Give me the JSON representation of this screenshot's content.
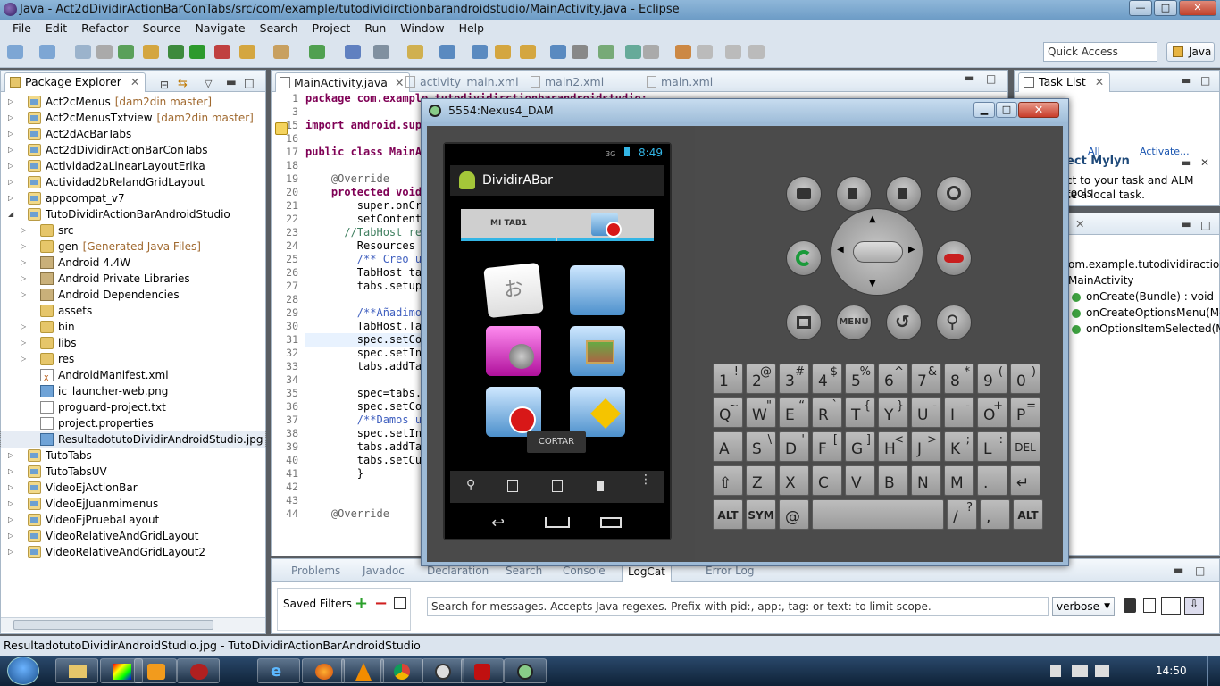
{
  "window": {
    "title": "Java - Act2dDividirActionBarConTabs/src/com/example/tutodividirctionbarandroidstudio/MainActivity.java - Eclipse",
    "min": "—",
    "max": "□",
    "close": "✕"
  },
  "menu": [
    "File",
    "Edit",
    "Refactor",
    "Source",
    "Navigate",
    "Search",
    "Project",
    "Run",
    "Window",
    "Help"
  ],
  "toolbar": {
    "quick_access": "Quick Access",
    "perspective": "Java"
  },
  "package_explorer": {
    "title": "Package Explorer",
    "items": [
      {
        "label": "Act2cMenus",
        "deco": "[dam2din master]",
        "indent": 0,
        "type": "proj",
        "tw": "▷"
      },
      {
        "label": "Act2cMenusTxtview",
        "deco": "[dam2din master]",
        "indent": 0,
        "type": "proj",
        "tw": "▷"
      },
      {
        "label": "Act2dAcBarTabs",
        "deco": "",
        "indent": 0,
        "type": "proj",
        "tw": "▷"
      },
      {
        "label": "Act2dDividirActionBarConTabs",
        "deco": "",
        "indent": 0,
        "type": "proj",
        "tw": "▷"
      },
      {
        "label": "Actividad2aLinearLayoutErika",
        "deco": "",
        "indent": 0,
        "type": "proj",
        "tw": "▷"
      },
      {
        "label": "Actividad2bRelandGridLayout",
        "deco": "",
        "indent": 0,
        "type": "proj",
        "tw": "▷"
      },
      {
        "label": "appcompat_v7",
        "deco": "",
        "indent": 0,
        "type": "proj",
        "tw": "▷"
      },
      {
        "label": "TutoDividirActionBarAndroidStudio",
        "deco": "",
        "indent": 0,
        "type": "proj",
        "tw": "◢"
      },
      {
        "label": "src",
        "deco": "",
        "indent": 1,
        "type": "fold",
        "tw": "▷"
      },
      {
        "label": "gen",
        "deco": "[Generated Java Files]",
        "indent": 1,
        "type": "fold",
        "tw": "▷"
      },
      {
        "label": "Android 4.4W",
        "deco": "",
        "indent": 1,
        "type": "jar",
        "tw": "▷"
      },
      {
        "label": "Android Private Libraries",
        "deco": "",
        "indent": 1,
        "type": "jar",
        "tw": "▷"
      },
      {
        "label": "Android Dependencies",
        "deco": "",
        "indent": 1,
        "type": "jar",
        "tw": "▷"
      },
      {
        "label": "assets",
        "deco": "",
        "indent": 1,
        "type": "fold",
        "tw": ""
      },
      {
        "label": "bin",
        "deco": "",
        "indent": 1,
        "type": "fold",
        "tw": "▷"
      },
      {
        "label": "libs",
        "deco": "",
        "indent": 1,
        "type": "fold",
        "tw": "▷"
      },
      {
        "label": "res",
        "deco": "",
        "indent": 1,
        "type": "fold",
        "tw": "▷"
      },
      {
        "label": "AndroidManifest.xml",
        "deco": "",
        "indent": 1,
        "type": "xmlf",
        "tw": ""
      },
      {
        "label": "ic_launcher-web.png",
        "deco": "",
        "indent": 1,
        "type": "imgf",
        "tw": ""
      },
      {
        "label": "proguard-project.txt",
        "deco": "",
        "indent": 1,
        "type": "file",
        "tw": ""
      },
      {
        "label": "project.properties",
        "deco": "",
        "indent": 1,
        "type": "file",
        "tw": ""
      },
      {
        "label": "ResultadotutoDividirAndroidStudio.jpg",
        "deco": "",
        "indent": 1,
        "type": "imgf",
        "tw": "",
        "selected": true
      },
      {
        "label": "TutoTabs",
        "deco": "",
        "indent": 0,
        "type": "proj",
        "tw": "▷"
      },
      {
        "label": "TutoTabsUV",
        "deco": "",
        "indent": 0,
        "type": "proj",
        "tw": "▷"
      },
      {
        "label": "VideoEjActionBar",
        "deco": "",
        "indent": 0,
        "type": "proj",
        "tw": "▷"
      },
      {
        "label": "VideoEjJuanmimenus",
        "deco": "",
        "indent": 0,
        "type": "proj",
        "tw": "▷"
      },
      {
        "label": "VideoEjPruebaLayout",
        "deco": "",
        "indent": 0,
        "type": "proj",
        "tw": "▷"
      },
      {
        "label": "VideoRelativeAndGridLayout",
        "deco": "",
        "indent": 0,
        "type": "proj",
        "tw": "▷"
      },
      {
        "label": "VideoRelativeAndGridLayout2",
        "deco": "",
        "indent": 0,
        "type": "proj",
        "tw": "▷"
      }
    ]
  },
  "editor": {
    "tabs": [
      "MainActivity.java",
      "activity_main.xml",
      "main2.xml",
      "main.xml"
    ],
    "line_numbers": [
      "1",
      "3",
      "15",
      "16",
      "17",
      "18",
      "19",
      "20",
      "21",
      "22",
      "23",
      "24",
      "25",
      "26",
      "27",
      "28",
      "29",
      "30",
      "31",
      "32",
      "33",
      "34",
      "35",
      "36",
      "37",
      "38",
      "39",
      "40",
      "41",
      "42",
      "43",
      "44"
    ],
    "code": [
      "package com.example.tutodividirctionbarandroidstudio;",
      "",
      "import android.support",
      "",
      "public class MainActivity",
      "",
      "    @Override",
      "    protected void",
      "        super.onCreate",
      "        setContentView",
      "      //TabHost res",
      "        Resources r",
      "        /** Creo un",
      "        TabHost tab",
      "        tabs.setup(",
      "",
      "        /**Añadimos",
      "        TabHost.Tab",
      "        spec.setCon",
      "        spec.setInd",
      "        tabs.addTab",
      "",
      "        spec=tabs.n",
      "        spec.setCon",
      "        /**Damos u",
      "        spec.setInd",
      "        tabs.addTab",
      "        tabs.setCur",
      "        }",
      "",
      "",
      "    @Override"
    ]
  },
  "task_list": {
    "title": "Task List",
    "find": "All",
    "activate": "Activate...",
    "mylyn_title": "ect Mylyn",
    "mylyn_line1": "ct to your task and ALM tools",
    "mylyn_line2": "te a local task."
  },
  "outline": {
    "items": [
      "om.example.tutodividiractionb",
      "MainActivity",
      "onCreate(Bundle) : void",
      "onCreateOptionsMenu(Me",
      "onOptionsItemSelected(Me"
    ]
  },
  "bottom": {
    "tabs": [
      "Problems",
      "Javadoc",
      "Declaration",
      "Search",
      "Console",
      "LogCat",
      "Error Log"
    ],
    "saved_filters": "Saved Filters",
    "search_placeholder": "Search for messages. Accepts Java regexes. Prefix with pid:, app:, tag: or text: to limit scope.",
    "level": "verbose"
  },
  "statusbar": {
    "text": "ResultadotutoDividirAndroidStudio.jpg - TutoDividirActionBarAndroidStudio"
  },
  "emulator": {
    "title": "5554:Nexus4_DAM",
    "phone": {
      "time": "8:49",
      "network": "3G",
      "app_title": "DividirABar",
      "tab1": "MI TAB1",
      "toast": "CORTAR"
    },
    "menu_key": "MENU",
    "keyboard": [
      [
        [
          "1",
          "!"
        ],
        [
          "2",
          "@"
        ],
        [
          "3",
          "#"
        ],
        [
          "4",
          "$"
        ],
        [
          "5",
          "%"
        ],
        [
          "6",
          "^"
        ],
        [
          "7",
          "&"
        ],
        [
          "8",
          "*"
        ],
        [
          "9",
          "("
        ],
        [
          "0",
          ")"
        ]
      ],
      [
        [
          "Q",
          "~"
        ],
        [
          "W",
          "\""
        ],
        [
          "E",
          "“"
        ],
        [
          "R",
          "`"
        ],
        [
          "T",
          "{"
        ],
        [
          "Y",
          "}"
        ],
        [
          "U",
          "-"
        ],
        [
          "I",
          "-"
        ],
        [
          "O",
          "+"
        ],
        [
          "P",
          "="
        ]
      ],
      [
        [
          "A",
          ""
        ],
        [
          "S",
          "\\"
        ],
        [
          "D",
          "'"
        ],
        [
          "F",
          "["
        ],
        [
          "G",
          "]"
        ],
        [
          "H",
          "<"
        ],
        [
          "J",
          ">"
        ],
        [
          "K",
          ";"
        ],
        [
          "L",
          ":"
        ],
        [
          "DEL",
          ""
        ]
      ],
      [
        [
          "⇧",
          ""
        ],
        [
          "Z",
          ""
        ],
        [
          "X",
          ""
        ],
        [
          "C",
          ""
        ],
        [
          "V",
          ""
        ],
        [
          "B",
          ""
        ],
        [
          "N",
          ""
        ],
        [
          "M",
          ""
        ],
        [
          ".",
          ""
        ],
        [
          "↵",
          ""
        ]
      ],
      [
        [
          "ALT",
          ""
        ],
        [
          "SYM",
          ""
        ],
        [
          "@",
          ""
        ],
        [
          "",
          ""
        ],
        [
          "/",
          "?"
        ],
        [
          ",",
          ""
        ],
        [
          "ALT",
          ""
        ]
      ]
    ]
  },
  "taskbar": {
    "clock": "14:50"
  }
}
